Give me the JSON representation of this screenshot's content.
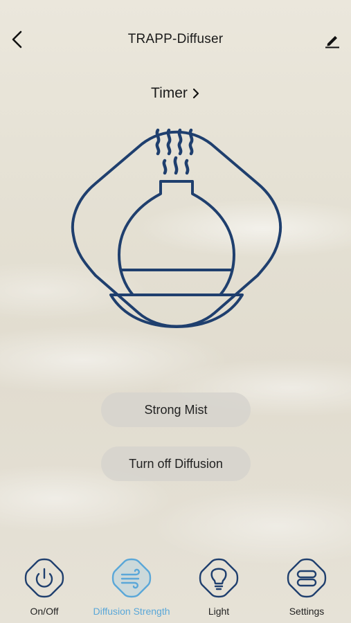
{
  "header": {
    "title": "TRAPP-Diffuser"
  },
  "timer": {
    "label": "Timer"
  },
  "controls": {
    "mist_label": "Strong Mist",
    "diffusion_label": "Turn off Diffusion"
  },
  "nav": {
    "items": [
      {
        "label": "On/Off",
        "icon": "power-icon",
        "active": false
      },
      {
        "label": "Diffusion Strength",
        "icon": "wind-icon",
        "active": true
      },
      {
        "label": "Light",
        "icon": "lightbulb-icon",
        "active": false
      },
      {
        "label": "Settings",
        "icon": "toggles-icon",
        "active": false
      }
    ]
  },
  "colors": {
    "icon_stroke": "#1f3f6e",
    "active_accent": "#5aa7d8",
    "text": "#1a1a1a"
  }
}
